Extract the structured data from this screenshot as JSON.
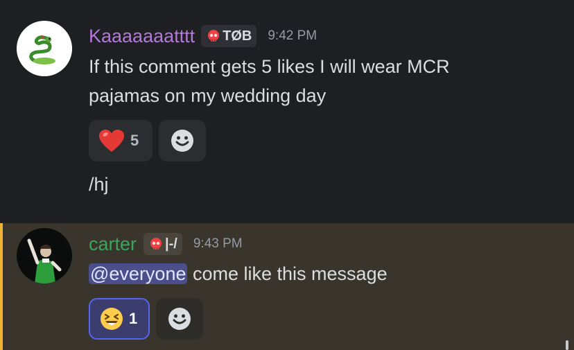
{
  "messages": [
    {
      "author": "Kaaaaaaatttt",
      "author_color": "#b478d8",
      "role_tag": "TØB",
      "time": "9:42 PM",
      "text_line1": "If this comment gets 5 likes I will wear MCR",
      "text_line1b": "pajamas on my wedding day",
      "reactions": [
        {
          "emoji": "heart-emoji",
          "count": "5"
        },
        {
          "emoji": "add-reaction-icon",
          "count": ""
        }
      ],
      "followup_text": "/hj"
    },
    {
      "author": "carter",
      "author_color": "#3ba55c",
      "role_tag": "|-/",
      "time": "9:43 PM",
      "mention": "@everyone",
      "text_rest": " come like this message",
      "highlight_color": "#f0b232",
      "reactions": [
        {
          "emoji": "laughing-emoji",
          "count": "1"
        },
        {
          "emoji": "add-reaction-icon",
          "count": ""
        }
      ]
    }
  ]
}
